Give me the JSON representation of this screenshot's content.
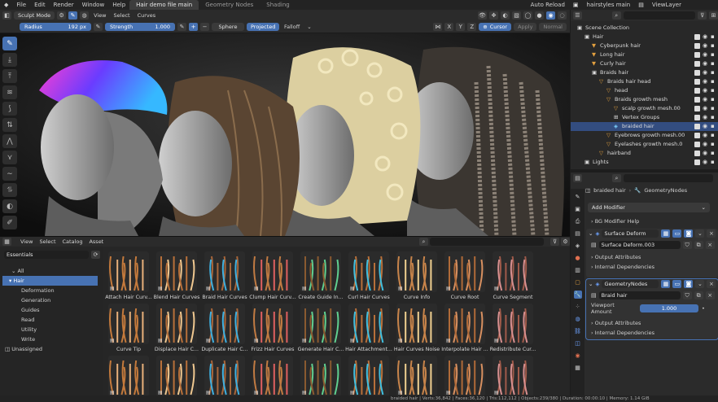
{
  "menubar": {
    "items": [
      "File",
      "Edit",
      "Render",
      "Window",
      "Help"
    ],
    "workspaces": [
      "Hair demo file main",
      "Geometry Nodes",
      "Shading"
    ],
    "auto_reload": "Auto Reload",
    "scene": "hairstyles main",
    "view_layer": "ViewLayer"
  },
  "header": {
    "mode": "Sculpt Mode",
    "menus": [
      "View",
      "Select",
      "Curves"
    ]
  },
  "toolsettings": {
    "radius_label": "Radius",
    "radius_value": "192 px",
    "strength_label": "Strength",
    "strength_value": "1.000",
    "sphere": "Sphere",
    "projected": "Projected",
    "falloff": "Falloff",
    "axes": [
      "X",
      "Y",
      "Z"
    ],
    "cursor": "Cursor",
    "apply": "Apply",
    "normal": "Normal"
  },
  "asset_browser": {
    "menus": [
      "View",
      "Select",
      "Catalog",
      "Asset"
    ],
    "library": "Essentials",
    "tree": [
      "All",
      "Hair",
      "Deformation",
      "Generation",
      "Guides",
      "Read",
      "Utility",
      "Write",
      "Unassigned"
    ],
    "assets": [
      "Attach Hair Curv...",
      "Blend Hair Curves",
      "Braid Hair Curves",
      "Clump Hair Curv...",
      "Create Guide In...",
      "Curl Hair Curves",
      "Curve Info",
      "Curve Root",
      "Curve Segment",
      "Curve Tip",
      "Displace Hair C...",
      "Duplicate Hair C...",
      "Frizz Hair Curves",
      "Generate Hair C...",
      "Hair Attachment...",
      "Hair Curves Noise",
      "Interpolate Hair ...",
      "Redistribute Cur...",
      "",
      "",
      "",
      "",
      "",
      "",
      "",
      "",
      ""
    ]
  },
  "outliner": {
    "rows": [
      "Scene Collection",
      "Hair",
      "Cyberpunk hair",
      "Long hair",
      "Curly hair",
      "Braids hair",
      "Braids hair head",
      "head",
      "Braids growth mesh",
      "scalp growth mesh.00",
      "Vertex Groups",
      "braided hair",
      "Eyebrows growth mesh.00",
      "Eyelashes growth mesh.0",
      "hairband",
      "Lights"
    ]
  },
  "properties": {
    "object": "braided hair",
    "modifier_type": "GeometryNodes",
    "add_modifier": "Add Modifier",
    "bg_help": "BG Modifier Help",
    "mod1": "Surface Deform",
    "mod1_target": "Surface Deform.003",
    "output_attrs": "Output Attributes",
    "internal_deps": "Internal Dependencies",
    "mod2": "GeometryNodes",
    "mod2_group": "Braid hair",
    "viewport_amount_label": "Viewport Amount",
    "viewport_amount": "1.000",
    "output_attrs2": "Output Attributes",
    "internal_deps2": "Internal Dependencies"
  },
  "statusbar": {
    "text": "braided hair | Verts:36,842 | Faces:36,120 | Tris:112,112 | Objects:239/380 | Duration: 00:00:10 | Memory: 1.14 GiB"
  },
  "colors": {
    "accent": "#4772b3",
    "selection": "#334d80",
    "hair_brown": "#b8703a"
  }
}
